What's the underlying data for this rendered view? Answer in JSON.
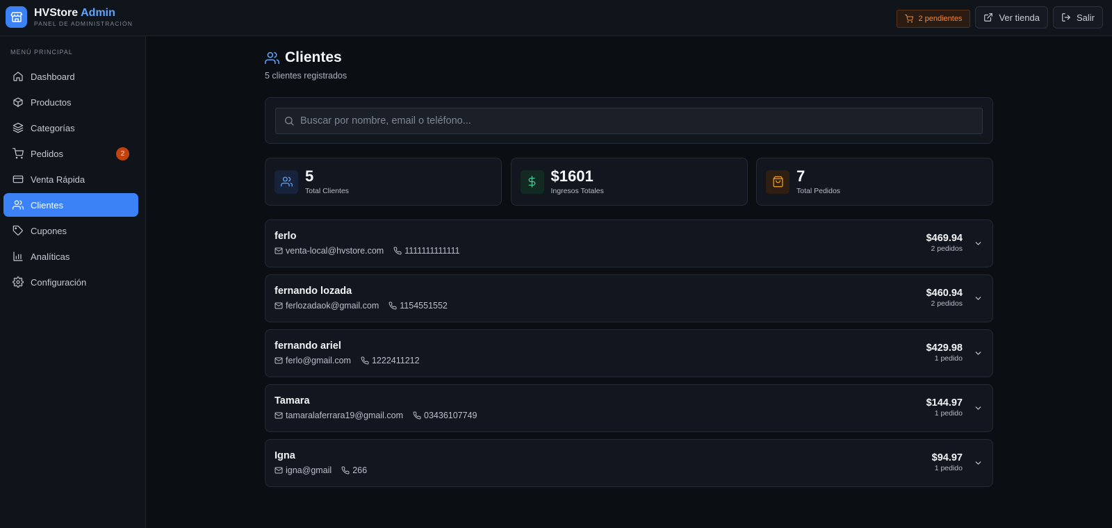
{
  "brand": {
    "name": "HVStore",
    "accent": "Admin",
    "subtitle": "PANEL DE ADMINISTRACIÓN",
    "color": "#3b82f6"
  },
  "topbar": {
    "pending_label": "2 pendientes",
    "store_label": "Ver tienda",
    "logout_label": "Salir"
  },
  "sidebar": {
    "section_title": "MENÚ PRINCIPAL",
    "items": [
      {
        "label": "Dashboard",
        "icon": "home-icon"
      },
      {
        "label": "Productos",
        "icon": "box-icon"
      },
      {
        "label": "Categorías",
        "icon": "layers-icon"
      },
      {
        "label": "Pedidos",
        "icon": "cart-icon",
        "badge": "2"
      },
      {
        "label": "Venta Rápida",
        "icon": "credit-card-icon"
      },
      {
        "label": "Clientes",
        "icon": "users-icon",
        "active": true
      },
      {
        "label": "Cupones",
        "icon": "tag-icon"
      },
      {
        "label": "Analíticas",
        "icon": "bar-chart-icon"
      },
      {
        "label": "Configuración",
        "icon": "gear-icon"
      }
    ]
  },
  "page": {
    "title": "Clientes",
    "subtitle": "5 clientes registrados"
  },
  "search": {
    "placeholder": "Buscar por nombre, email o teléfono...",
    "value": ""
  },
  "stats": [
    {
      "value": "5",
      "label": "Total Clientes",
      "icon": "users-icon",
      "color": "#60a5fa"
    },
    {
      "value": "$1601",
      "label": "Ingresos Totales",
      "icon": "dollar-icon",
      "color": "#34d399"
    },
    {
      "value": "7",
      "label": "Total Pedidos",
      "icon": "bag-icon",
      "color": "#f59e0b"
    }
  ],
  "clients": [
    {
      "name": "ferlo",
      "email": "venta-local@hvstore.com",
      "phone": "1111111111111",
      "total": "$469.94",
      "orders": "2 pedidos"
    },
    {
      "name": "fernando lozada",
      "email": "ferlozadaok@gmail.com",
      "phone": "1154551552",
      "total": "$460.94",
      "orders": "2 pedidos"
    },
    {
      "name": "fernando ariel",
      "email": "ferlo@gmail.com",
      "phone": "1222411212",
      "total": "$429.98",
      "orders": "1 pedido"
    },
    {
      "name": "Tamara",
      "email": "tamaralaferrara19@gmail.com",
      "phone": "03436107749",
      "total": "$144.97",
      "orders": "1 pedido"
    },
    {
      "name": "Igna",
      "email": "igna@gmail",
      "phone": "266",
      "total": "$94.97",
      "orders": "1 pedido"
    }
  ]
}
